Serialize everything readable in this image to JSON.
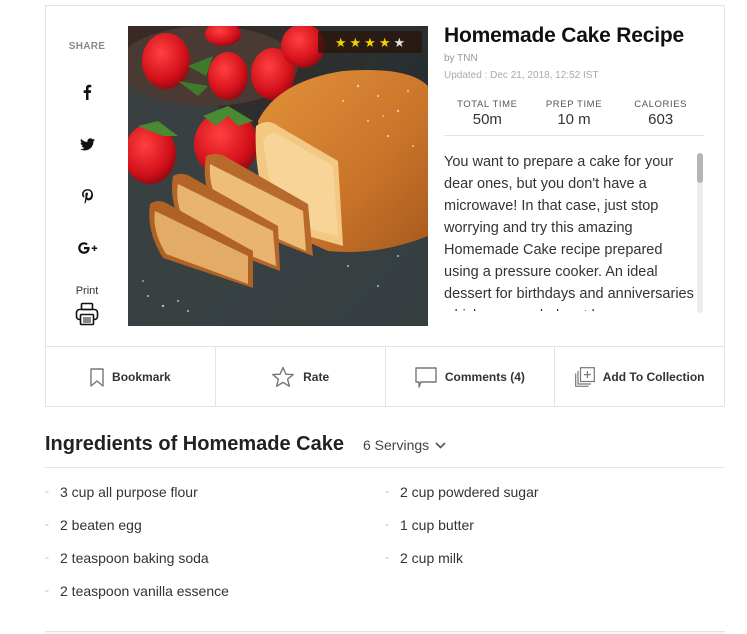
{
  "share": {
    "label": "SHARE",
    "items": [
      {
        "name": "facebook",
        "icon": "facebook-icon"
      },
      {
        "name": "twitter",
        "icon": "twitter-icon"
      },
      {
        "name": "pinterest",
        "icon": "pinterest-icon"
      },
      {
        "name": "google-plus",
        "icon": "google-plus-icon"
      }
    ],
    "print_label": "Print"
  },
  "recipe": {
    "title": "Homemade Cake Recipe",
    "byline": "by TNN",
    "updated": "Updated : Dec 21, 2018, 12:52 IST",
    "rating": {
      "value": 4,
      "max": 5,
      "filled_color": "#f5d000",
      "empty_color": "#e0e0e0"
    },
    "stats": [
      {
        "label": "TOTAL TIME",
        "value": "50m"
      },
      {
        "label": "PREP TIME",
        "value": "10 m"
      },
      {
        "label": "CALORIES",
        "value": "603"
      }
    ],
    "description": "You want to prepare a cake for your dear ones, but you don't have a microwave! In that case, just stop worrying and try this amazing Homemade Cake recipe prepared using a pressure cooker. An ideal dessert for birthdays and anniversaries which you can bake at home."
  },
  "actions": [
    {
      "label": "Bookmark",
      "icon": "bookmark-icon"
    },
    {
      "label": "Rate",
      "icon": "star-outline-icon"
    },
    {
      "label": "Comments (4)",
      "icon": "comment-icon"
    },
    {
      "label": "Add To Collection",
      "icon": "add-collection-icon"
    }
  ],
  "ingredients": {
    "title": "Ingredients of Homemade Cake",
    "servings": "6 Servings",
    "left": [
      "3 cup all purpose flour",
      "2 beaten egg",
      "2 teaspoon baking soda",
      "2 teaspoon vanilla essence"
    ],
    "right": [
      "2 cup powdered sugar",
      "1 cup butter",
      "2 cup milk"
    ]
  }
}
